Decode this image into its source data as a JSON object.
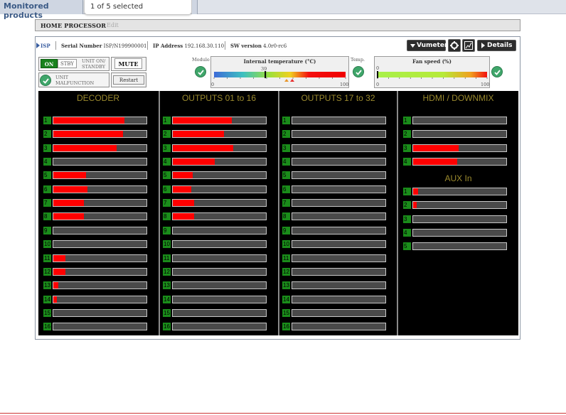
{
  "topbar": {
    "tab_label": "Monitored products",
    "selector_text": "1 of 5 selected"
  },
  "processor": {
    "name": "HOME PROCESSOR",
    "edit_label": "Edit"
  },
  "device": {
    "tag": "ISP",
    "serial_label": "Serial Number",
    "serial_value": "ISP/N199900001",
    "ip_label": "IP Address",
    "ip_value": "192.168.30.110",
    "sw_label": "SW version",
    "sw_value": "4.0r0-rc6"
  },
  "toolbar": {
    "vumeter_label": "Vumeter",
    "details_label": "Details"
  },
  "power": {
    "on_label": "ON",
    "stby_label": "STBY",
    "unit_on_standby": "UNIT ON/ STANDBY",
    "unit_malfunction": "UNIT MALFUNCTION",
    "mute_label": "MUTE",
    "restart_label": "Restart"
  },
  "status": {
    "module_label": "Module",
    "temp_label": "Temp."
  },
  "temperature": {
    "title": "Internal temperature (°C)",
    "current": 39,
    "min": "0",
    "max": "100"
  },
  "fan": {
    "title": "Fan speed (%)",
    "current": 0,
    "min": "0",
    "max": "100"
  },
  "meters": {
    "decoder": {
      "title": "DECODER",
      "levels": [
        0.76,
        0.75,
        0.68,
        0,
        0.35,
        0.37,
        0.33,
        0.33,
        0,
        0,
        0.13,
        0.13,
        0.05,
        0.04,
        0,
        0
      ]
    },
    "outputs_1_16": {
      "title": "OUTPUTS 01 to 16",
      "levels": [
        0.63,
        0.55,
        0.65,
        0.45,
        0.21,
        0.2,
        0.23,
        0.23,
        0,
        0,
        0,
        0,
        0,
        0,
        0,
        0
      ]
    },
    "outputs_17_32": {
      "title": "OUTPUTS 17 to 32",
      "levels": [
        0,
        0,
        0,
        0,
        0,
        0,
        0,
        0,
        0,
        0,
        0,
        0,
        0,
        0,
        0,
        0
      ]
    },
    "hdmi_downmix": {
      "title": "HDMI / DOWNMIX",
      "levels": [
        0,
        0,
        0.49,
        0.47
      ]
    },
    "aux_in": {
      "title": "AUX In",
      "levels": [
        0.05,
        0.04,
        0,
        0,
        0
      ]
    }
  },
  "colors": {
    "accent_green": "#19821e",
    "meter_red": "#ff0000",
    "meter_title": "#9b8a2e",
    "link_blue": "#3a5ea0"
  }
}
